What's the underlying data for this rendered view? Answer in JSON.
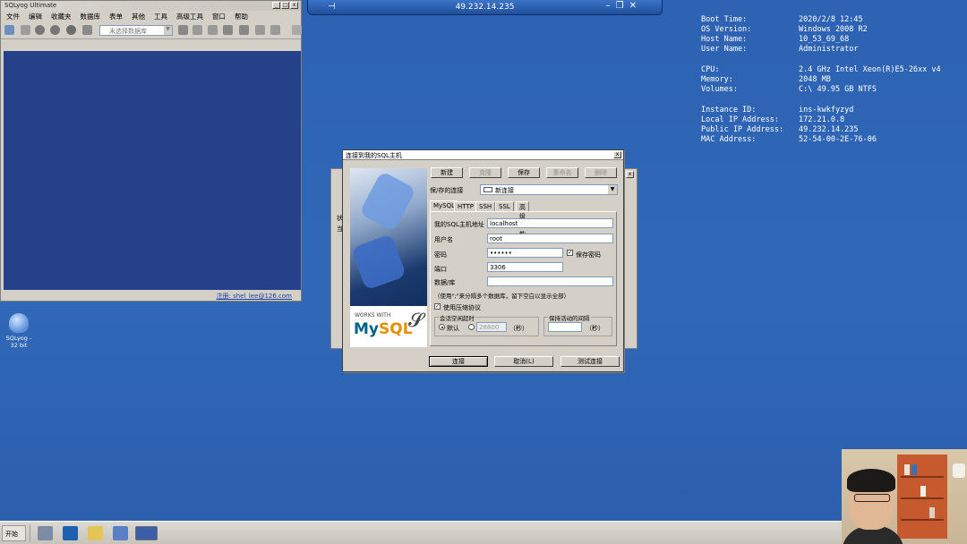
{
  "rdp": {
    "ip": "49.232.14.235"
  },
  "bginfo": [
    {
      "k": "Boot Time:",
      "v": "2020/2/8 12:45"
    },
    {
      "k": "OS Version:",
      "v": "Windows 2008 R2"
    },
    {
      "k": "Host Name:",
      "v": "10_53_69_68"
    },
    {
      "k": "User Name:",
      "v": "Administrator"
    },
    {
      "k": "CPU:",
      "v": "2.4 GHz Intel Xeon(R)E5-26xx v4"
    },
    {
      "k": "Memory:",
      "v": "2048 MB"
    },
    {
      "k": "Volumes:",
      "v": "C:\\ 49.95 GB NTFS"
    },
    {
      "k": "Instance ID:",
      "v": "ins-kwkfyzyd"
    },
    {
      "k": "Local IP Address:",
      "v": "172.21.0.8"
    },
    {
      "k": "Public IP Address:",
      "v": "49.232.14.235"
    },
    {
      "k": "MAC Address:",
      "v": "52-54-00-2E-76-06"
    }
  ],
  "sqlyog": {
    "title": "SQLyog Ultimate",
    "menu": [
      "文件",
      "编辑",
      "收藏夹",
      "数据库",
      "表单",
      "其他",
      "工具",
      "高级工具",
      "窗口",
      "帮助"
    ],
    "db_placeholder": "未选择数据库",
    "status": "注册: shel_lee@126.com"
  },
  "desktop_icon": {
    "label": "SQLyog - 32 bit"
  },
  "back_dialog": {
    "labels": [
      "状",
      "当"
    ]
  },
  "dialog": {
    "title": "连接到我的SQL主机",
    "toolbar": {
      "new": "新建",
      "clone": "克隆",
      "save": "保存",
      "rename": "重命名",
      "delete": "删除"
    },
    "saved_label": "保/存的连接",
    "saved_value": "新连接",
    "tabs": [
      "MySQL",
      "HTTP",
      "SSH",
      "SSL",
      "高级功能"
    ],
    "host_label": "我的SQL主机地址",
    "host_value": "localhost",
    "user_label": "用户名",
    "user_value": "root",
    "pass_label": "密码",
    "pass_value": "••••••",
    "save_pass_label": "保存密码",
    "port_label": "端口",
    "port_value": "3306",
    "db_label": "数据/库",
    "db_value": "",
    "db_hint": "（使用\";\"来分隔多个数据库，留下空白以显示全部）",
    "compress_label": "使用压缩协议",
    "session_group": "会话空闲超时",
    "default_label": "默认",
    "timeout_value": "28800",
    "sec1": "（秒）",
    "keepalive_group": "保持活动的间隔",
    "sec2": "（秒）",
    "connect": "连接",
    "cancel": "取消(L)",
    "test": "测试连接",
    "logo_works": "WORKS WITH",
    "logo_my": "My",
    "logo_sql": "SQL"
  },
  "taskbar": {
    "start": "开始"
  }
}
